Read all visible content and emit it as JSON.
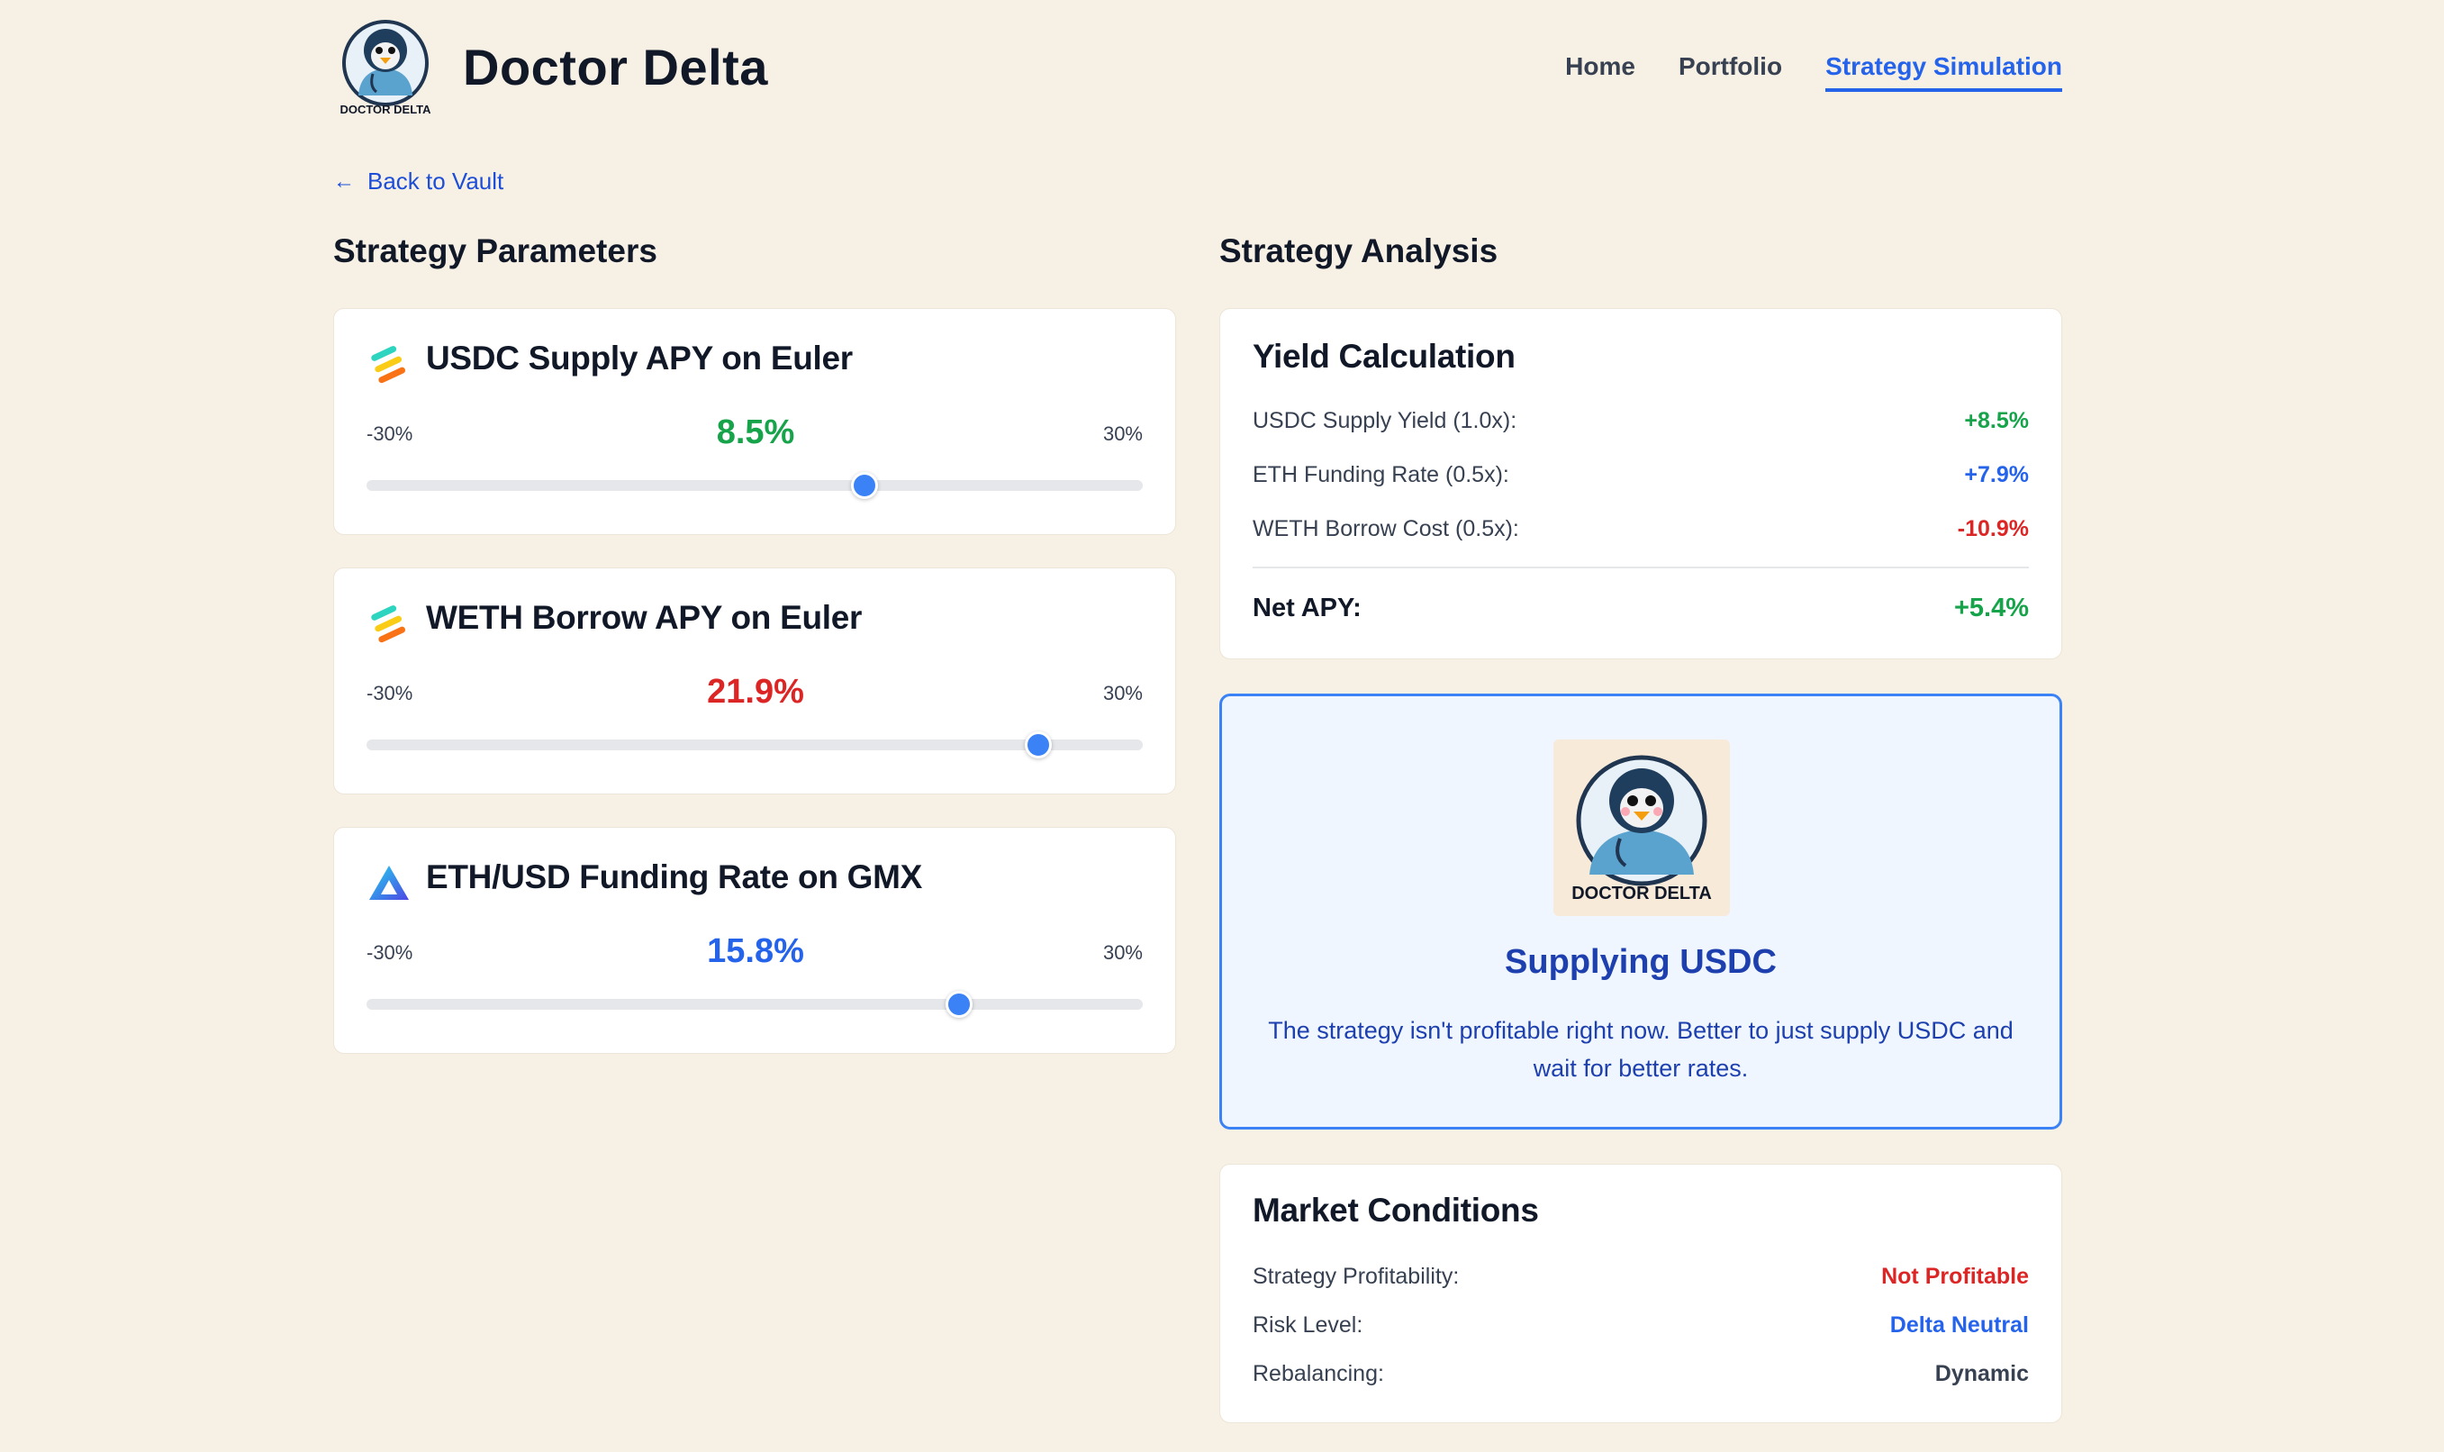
{
  "header": {
    "logo_text": "DOCTOR DELTA",
    "brand": "Doctor Delta",
    "nav": [
      {
        "label": "Home",
        "active": false
      },
      {
        "label": "Portfolio",
        "active": false
      },
      {
        "label": "Strategy Simulation",
        "active": true
      }
    ]
  },
  "back_link": "Back to Vault",
  "left": {
    "title": "Strategy Parameters",
    "params": [
      {
        "title": "USDC Supply APY on Euler",
        "icon": "euler-icon",
        "min": "-30%",
        "max": "30%",
        "value_text": "8.5%",
        "value": 8.5,
        "color": "#16a34a"
      },
      {
        "title": "WETH Borrow APY on Euler",
        "icon": "euler-icon",
        "min": "-30%",
        "max": "30%",
        "value_text": "21.9%",
        "value": 21.9,
        "color": "#dc2626"
      },
      {
        "title": "ETH/USD Funding Rate on GMX",
        "icon": "gmx-icon",
        "min": "-30%",
        "max": "30%",
        "value_text": "15.8%",
        "value": 15.8,
        "color": "#2563eb"
      }
    ]
  },
  "right": {
    "title": "Strategy Analysis",
    "yield": {
      "title": "Yield Calculation",
      "rows": [
        {
          "label": "USDC Supply Yield (1.0x):",
          "value": "+8.5%",
          "color": "#16a34a"
        },
        {
          "label": "ETH Funding Rate (0.5x):",
          "value": "+7.9%",
          "color": "#2563eb"
        },
        {
          "label": "WETH Borrow Cost (0.5x):",
          "value": "-10.9%",
          "color": "#dc2626"
        }
      ],
      "net_label": "Net APY:",
      "net_value": "+5.4%",
      "net_color": "#16a34a"
    },
    "recommendation": {
      "avatar_text": "DOCTOR DELTA",
      "heading": "Supplying USDC",
      "text": "The strategy isn't profitable right now. Better to just supply USDC and wait for better rates."
    },
    "market": {
      "title": "Market Conditions",
      "rows": [
        {
          "label": "Strategy Profitability:",
          "value": "Not Profitable",
          "color": "#dc2626"
        },
        {
          "label": "Risk Level:",
          "value": "Delta Neutral",
          "color": "#2563eb"
        },
        {
          "label": "Rebalancing:",
          "value": "Dynamic",
          "color": "#374151"
        }
      ]
    }
  }
}
